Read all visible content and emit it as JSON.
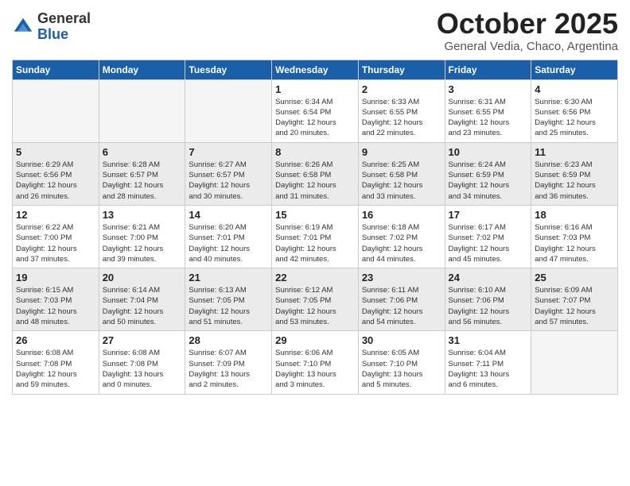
{
  "header": {
    "logo_general": "General",
    "logo_blue": "Blue",
    "month_title": "October 2025",
    "subtitle": "General Vedia, Chaco, Argentina"
  },
  "days_of_week": [
    "Sunday",
    "Monday",
    "Tuesday",
    "Wednesday",
    "Thursday",
    "Friday",
    "Saturday"
  ],
  "weeks": [
    [
      {
        "day": "",
        "info": ""
      },
      {
        "day": "",
        "info": ""
      },
      {
        "day": "",
        "info": ""
      },
      {
        "day": "1",
        "info": "Sunrise: 6:34 AM\nSunset: 6:54 PM\nDaylight: 12 hours\nand 20 minutes."
      },
      {
        "day": "2",
        "info": "Sunrise: 6:33 AM\nSunset: 6:55 PM\nDaylight: 12 hours\nand 22 minutes."
      },
      {
        "day": "3",
        "info": "Sunrise: 6:31 AM\nSunset: 6:55 PM\nDaylight: 12 hours\nand 23 minutes."
      },
      {
        "day": "4",
        "info": "Sunrise: 6:30 AM\nSunset: 6:56 PM\nDaylight: 12 hours\nand 25 minutes."
      }
    ],
    [
      {
        "day": "5",
        "info": "Sunrise: 6:29 AM\nSunset: 6:56 PM\nDaylight: 12 hours\nand 26 minutes."
      },
      {
        "day": "6",
        "info": "Sunrise: 6:28 AM\nSunset: 6:57 PM\nDaylight: 12 hours\nand 28 minutes."
      },
      {
        "day": "7",
        "info": "Sunrise: 6:27 AM\nSunset: 6:57 PM\nDaylight: 12 hours\nand 30 minutes."
      },
      {
        "day": "8",
        "info": "Sunrise: 6:26 AM\nSunset: 6:58 PM\nDaylight: 12 hours\nand 31 minutes."
      },
      {
        "day": "9",
        "info": "Sunrise: 6:25 AM\nSunset: 6:58 PM\nDaylight: 12 hours\nand 33 minutes."
      },
      {
        "day": "10",
        "info": "Sunrise: 6:24 AM\nSunset: 6:59 PM\nDaylight: 12 hours\nand 34 minutes."
      },
      {
        "day": "11",
        "info": "Sunrise: 6:23 AM\nSunset: 6:59 PM\nDaylight: 12 hours\nand 36 minutes."
      }
    ],
    [
      {
        "day": "12",
        "info": "Sunrise: 6:22 AM\nSunset: 7:00 PM\nDaylight: 12 hours\nand 37 minutes."
      },
      {
        "day": "13",
        "info": "Sunrise: 6:21 AM\nSunset: 7:00 PM\nDaylight: 12 hours\nand 39 minutes."
      },
      {
        "day": "14",
        "info": "Sunrise: 6:20 AM\nSunset: 7:01 PM\nDaylight: 12 hours\nand 40 minutes."
      },
      {
        "day": "15",
        "info": "Sunrise: 6:19 AM\nSunset: 7:01 PM\nDaylight: 12 hours\nand 42 minutes."
      },
      {
        "day": "16",
        "info": "Sunrise: 6:18 AM\nSunset: 7:02 PM\nDaylight: 12 hours\nand 44 minutes."
      },
      {
        "day": "17",
        "info": "Sunrise: 6:17 AM\nSunset: 7:02 PM\nDaylight: 12 hours\nand 45 minutes."
      },
      {
        "day": "18",
        "info": "Sunrise: 6:16 AM\nSunset: 7:03 PM\nDaylight: 12 hours\nand 47 minutes."
      }
    ],
    [
      {
        "day": "19",
        "info": "Sunrise: 6:15 AM\nSunset: 7:03 PM\nDaylight: 12 hours\nand 48 minutes."
      },
      {
        "day": "20",
        "info": "Sunrise: 6:14 AM\nSunset: 7:04 PM\nDaylight: 12 hours\nand 50 minutes."
      },
      {
        "day": "21",
        "info": "Sunrise: 6:13 AM\nSunset: 7:05 PM\nDaylight: 12 hours\nand 51 minutes."
      },
      {
        "day": "22",
        "info": "Sunrise: 6:12 AM\nSunset: 7:05 PM\nDaylight: 12 hours\nand 53 minutes."
      },
      {
        "day": "23",
        "info": "Sunrise: 6:11 AM\nSunset: 7:06 PM\nDaylight: 12 hours\nand 54 minutes."
      },
      {
        "day": "24",
        "info": "Sunrise: 6:10 AM\nSunset: 7:06 PM\nDaylight: 12 hours\nand 56 minutes."
      },
      {
        "day": "25",
        "info": "Sunrise: 6:09 AM\nSunset: 7:07 PM\nDaylight: 12 hours\nand 57 minutes."
      }
    ],
    [
      {
        "day": "26",
        "info": "Sunrise: 6:08 AM\nSunset: 7:08 PM\nDaylight: 12 hours\nand 59 minutes."
      },
      {
        "day": "27",
        "info": "Sunrise: 6:08 AM\nSunset: 7:08 PM\nDaylight: 13 hours\nand 0 minutes."
      },
      {
        "day": "28",
        "info": "Sunrise: 6:07 AM\nSunset: 7:09 PM\nDaylight: 13 hours\nand 2 minutes."
      },
      {
        "day": "29",
        "info": "Sunrise: 6:06 AM\nSunset: 7:10 PM\nDaylight: 13 hours\nand 3 minutes."
      },
      {
        "day": "30",
        "info": "Sunrise: 6:05 AM\nSunset: 7:10 PM\nDaylight: 13 hours\nand 5 minutes."
      },
      {
        "day": "31",
        "info": "Sunrise: 6:04 AM\nSunset: 7:11 PM\nDaylight: 13 hours\nand 6 minutes."
      },
      {
        "day": "",
        "info": ""
      }
    ]
  ]
}
